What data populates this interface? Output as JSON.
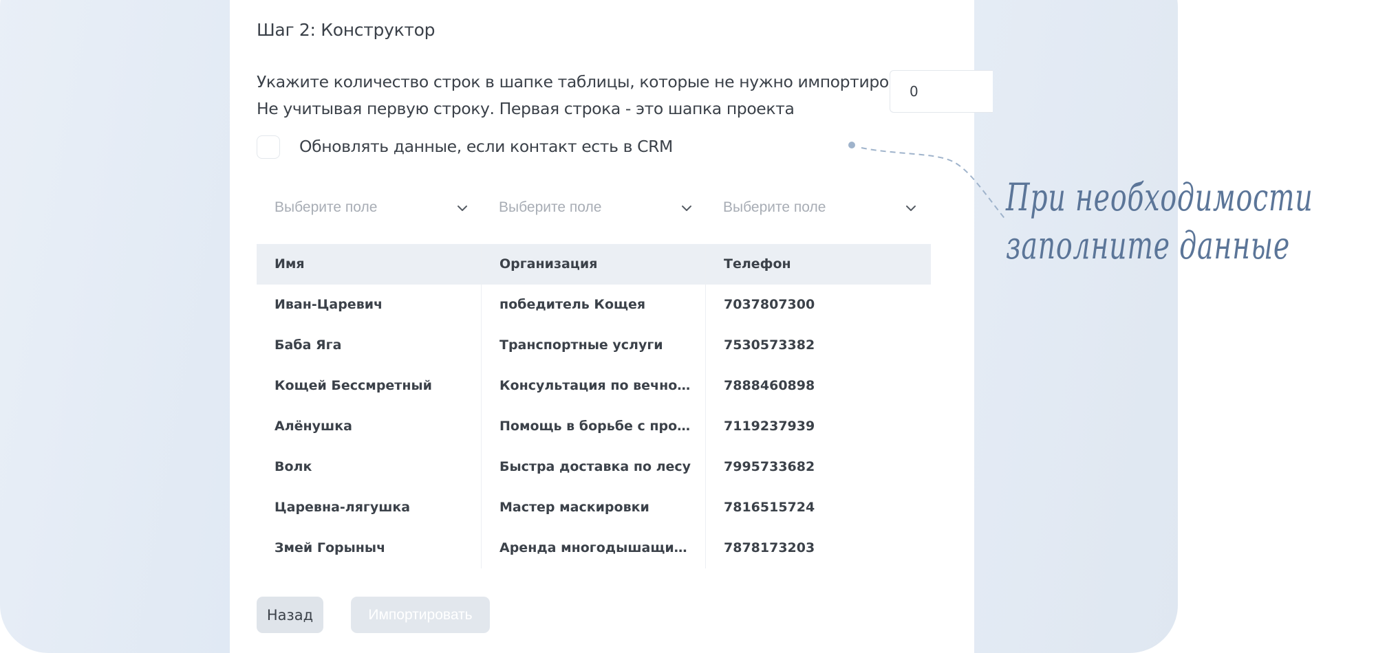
{
  "step_title": "Шаг 2: Конструктор",
  "description": {
    "line1": "Укажите количество строк в шапке таблицы, которые не нужно импортировать",
    "line2": "Не учитывая первую строку. Первая строка - это шапка проекта"
  },
  "skip_rows_input": {
    "value": "0"
  },
  "update_checkbox": {
    "label": "Обновлять данные, если контакт есть в CRM",
    "checked": false
  },
  "field_selects": [
    {
      "placeholder": "Выберите поле"
    },
    {
      "placeholder": "Выберите поле"
    },
    {
      "placeholder": "Выберите поле"
    }
  ],
  "table": {
    "headers": [
      "Имя",
      "Организация",
      "Телефон"
    ],
    "rows": [
      [
        "Иван-Царевич",
        "победитель Кощея",
        "7037807300"
      ],
      [
        "Баба Яга",
        "Транспортные услуги",
        "7530573382"
      ],
      [
        "Кощей Бессмретный",
        "Консультация по вечной жизни",
        "7888460898"
      ],
      [
        "Алёнушка",
        "Помощь в борьбе с проклятиями",
        "7119237939"
      ],
      [
        "Волк",
        "Быстра доставка по лесу",
        "7995733682"
      ],
      [
        "Царевна-лягушка",
        "Мастер маскировки",
        "7816515724"
      ],
      [
        "Змей Горыныч",
        "Аренда многодышащих услуг",
        "7878173203"
      ]
    ]
  },
  "buttons": {
    "back": "Назад",
    "import": "Импортировать"
  },
  "annotation": {
    "line1": "При необходимости",
    "line2": "заполните данные"
  },
  "colors": {
    "text": "#3b4149",
    "placeholder": "#a8adb5",
    "table_header_bg": "#ebeff4",
    "annotation": "#5b7598"
  }
}
